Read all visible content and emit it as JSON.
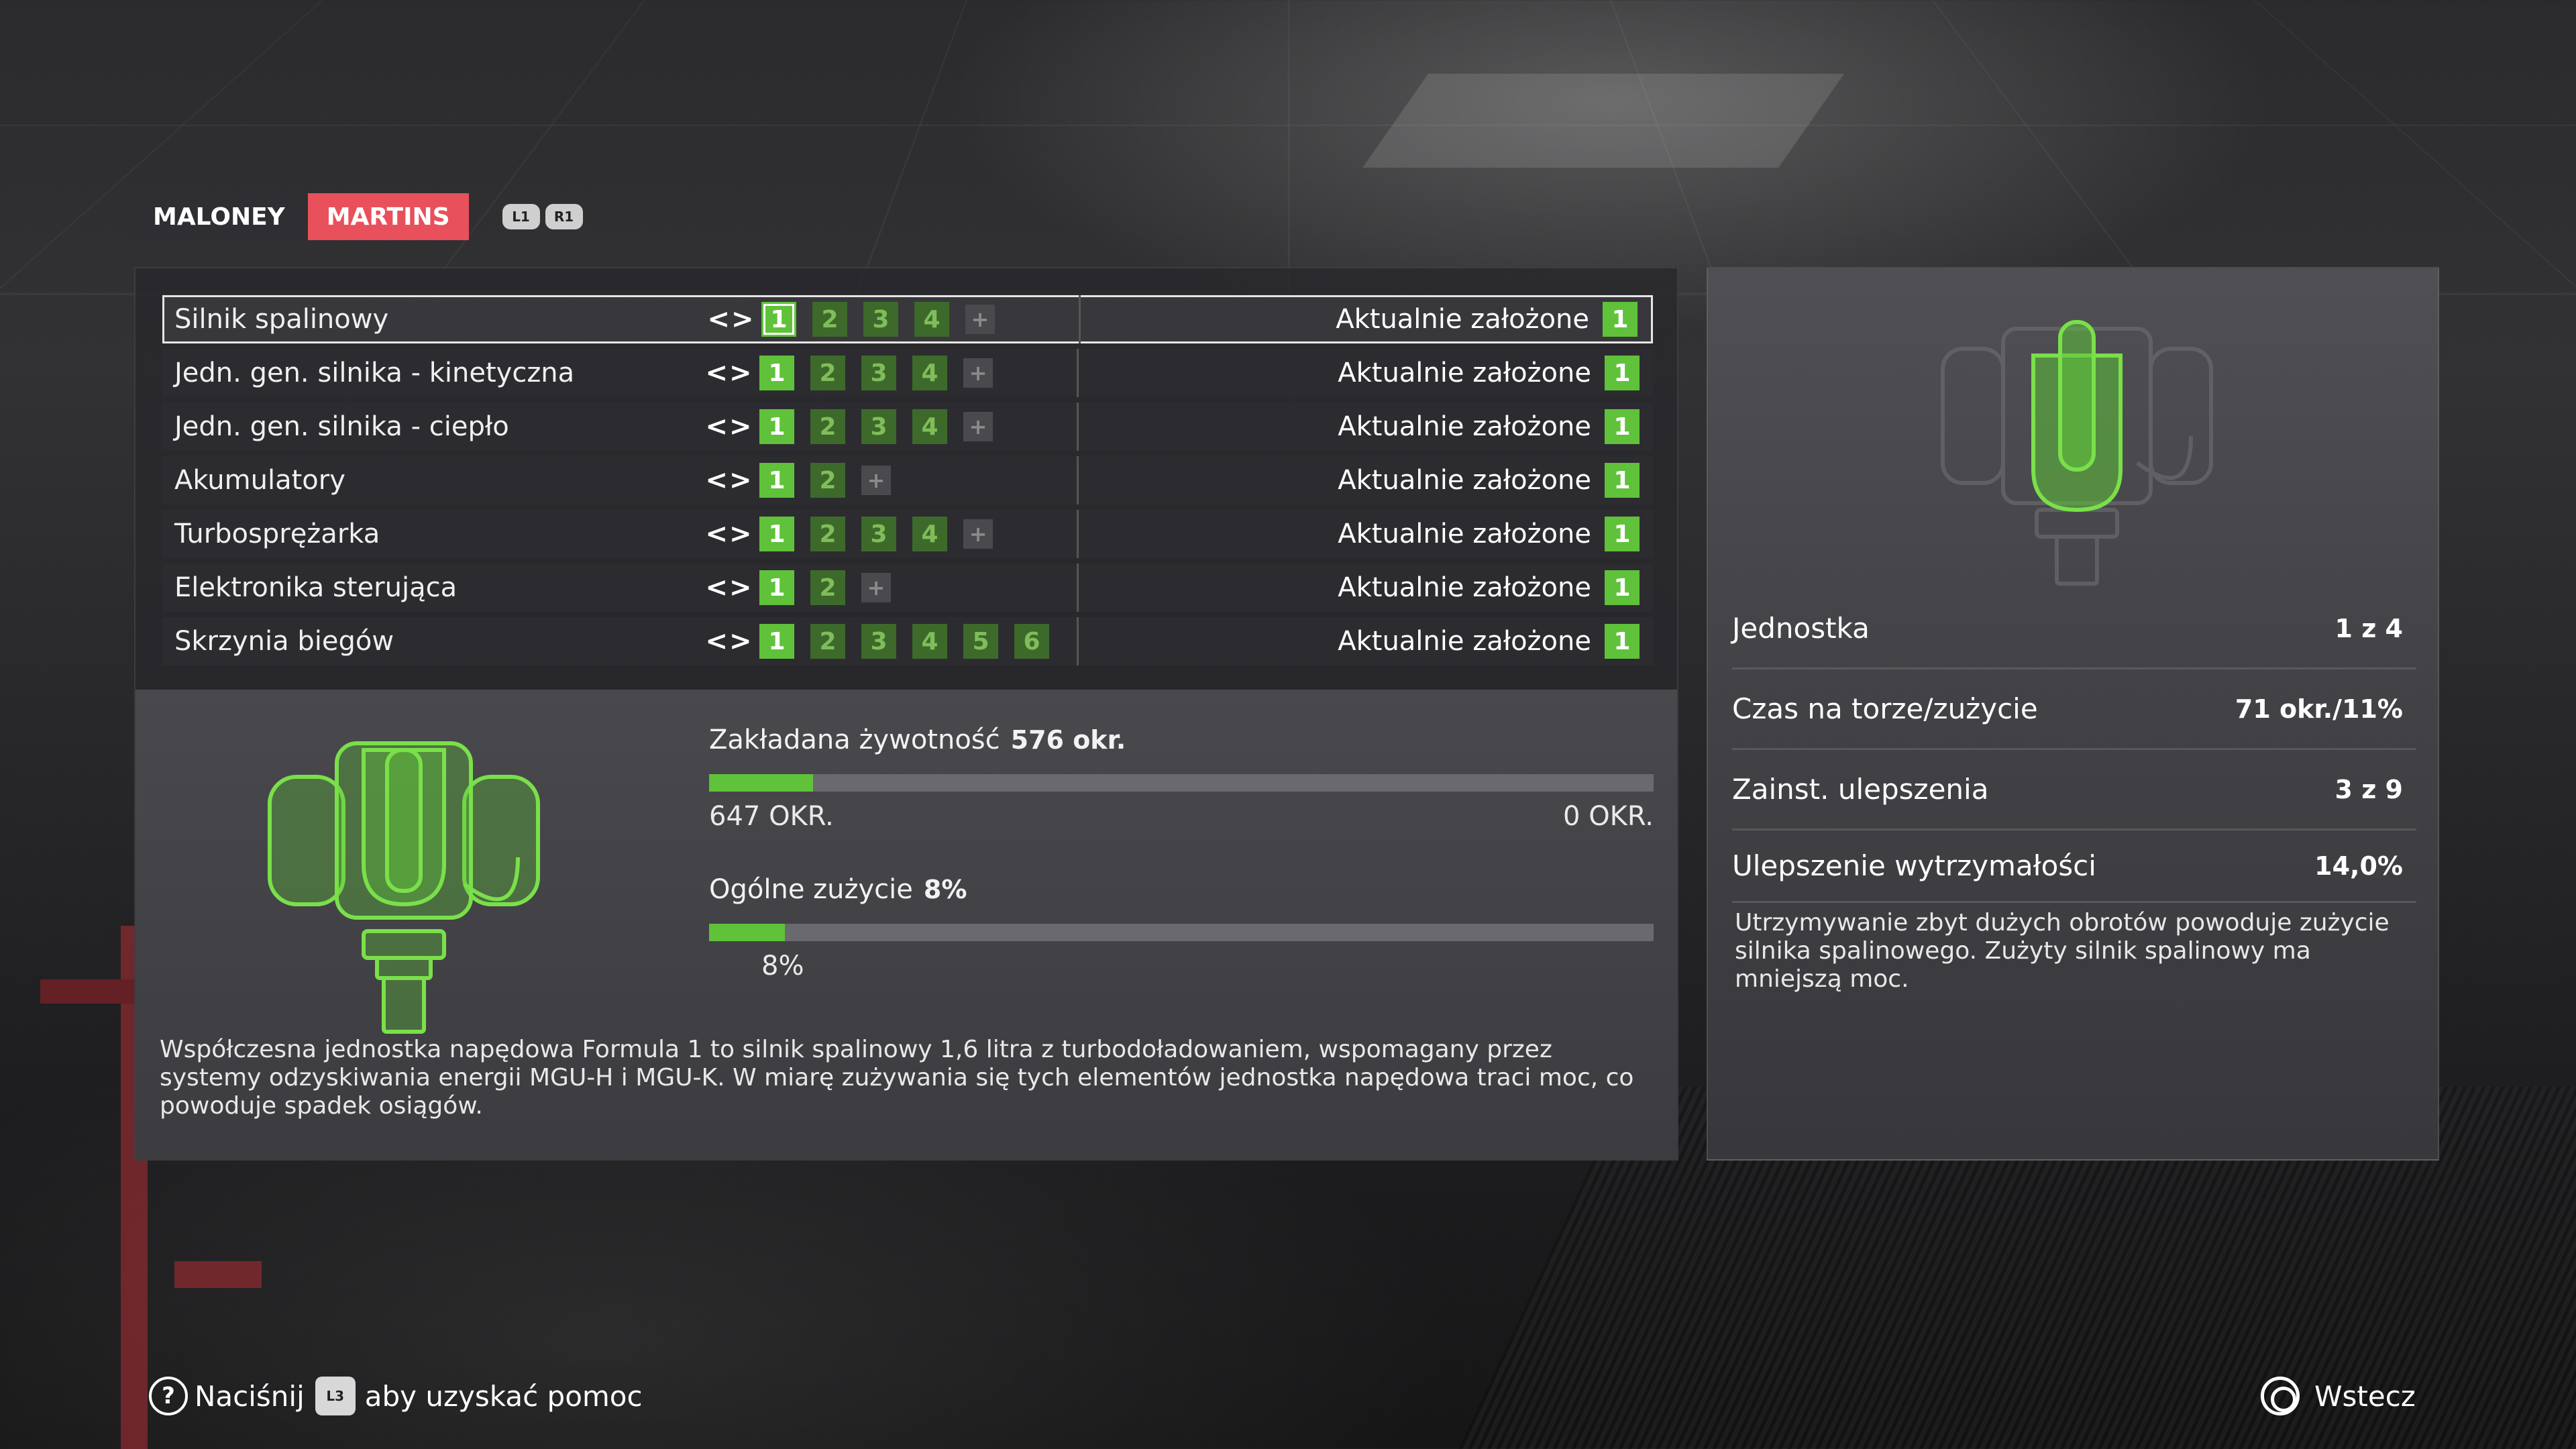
{
  "drivers": {
    "tabs": [
      {
        "label": "MALONEY",
        "active": false
      },
      {
        "label": "MARTINS",
        "active": true
      }
    ],
    "shoulder_left": "L1",
    "shoulder_right": "R1"
  },
  "parts": {
    "arrows": "<>",
    "fitted_label": "Aktualnie założone",
    "items": [
      {
        "name": "Silnik spalinowy",
        "units": [
          "1",
          "2",
          "3",
          "4"
        ],
        "has_plus": true,
        "fitted": "1",
        "selected": true
      },
      {
        "name": "Jedn. gen. silnika - kinetyczna",
        "units": [
          "1",
          "2",
          "3",
          "4"
        ],
        "has_plus": true,
        "fitted": "1",
        "selected": false
      },
      {
        "name": "Jedn. gen. silnika - ciepło",
        "units": [
          "1",
          "2",
          "3",
          "4"
        ],
        "has_plus": true,
        "fitted": "1",
        "selected": false
      },
      {
        "name": "Akumulatory",
        "units": [
          "1",
          "2"
        ],
        "has_plus": true,
        "fitted": "1",
        "selected": false
      },
      {
        "name": "Turbosprężarka",
        "units": [
          "1",
          "2",
          "3",
          "4"
        ],
        "has_plus": true,
        "fitted": "1",
        "selected": false
      },
      {
        "name": "Elektronika sterująca",
        "units": [
          "1",
          "2"
        ],
        "has_plus": true,
        "fitted": "1",
        "selected": false
      },
      {
        "name": "Skrzynia biegów",
        "units": [
          "1",
          "2",
          "3",
          "4",
          "5",
          "6"
        ],
        "has_plus": false,
        "fitted": "1",
        "selected": false
      }
    ]
  },
  "detail": {
    "life_label": "Zakładana żywotność",
    "life_value": "576 okr.",
    "life_bar_fraction": 0.11,
    "life_min": "647 OKR.",
    "life_max": "0 OKR.",
    "wear_label": "Ogólne zużycie",
    "wear_value": "8%",
    "wear_bar_fraction": 0.08,
    "wear_pct": "8%",
    "description": "Współczesna jednostka napędowa Formula 1 to silnik spalinowy 1,6 litra z turbodoładowaniem, wspomagany przez systemy odzyskiwania energii MGU-H i MGU-K. W miarę zużywania się tych elementów jednostka napędowa traci moc, co powoduje spadek osiągów."
  },
  "side": {
    "stats": [
      {
        "label": "Jednostka",
        "value": "1 z 4"
      },
      {
        "label": "Czas na torze/zużycie",
        "value": "71 okr./11%"
      },
      {
        "label": "Zainst. ulepszenia",
        "value": "3 z 9"
      },
      {
        "label": "Ulepszenie wytrzymałości",
        "value": "14,0%"
      }
    ],
    "description": "Utrzymywanie zbyt dużych obrotów powoduje zużycie silnika spalinowego. Zużyty silnik spalinowy ma mniejszą moc."
  },
  "footer": {
    "press": "Naciśnij",
    "l3": "L3",
    "help_text": "aby uzyskać pomoc",
    "back": "Wstecz"
  },
  "colors": {
    "accent_green": "#5fc23a",
    "active_tab": "#e8505b"
  }
}
